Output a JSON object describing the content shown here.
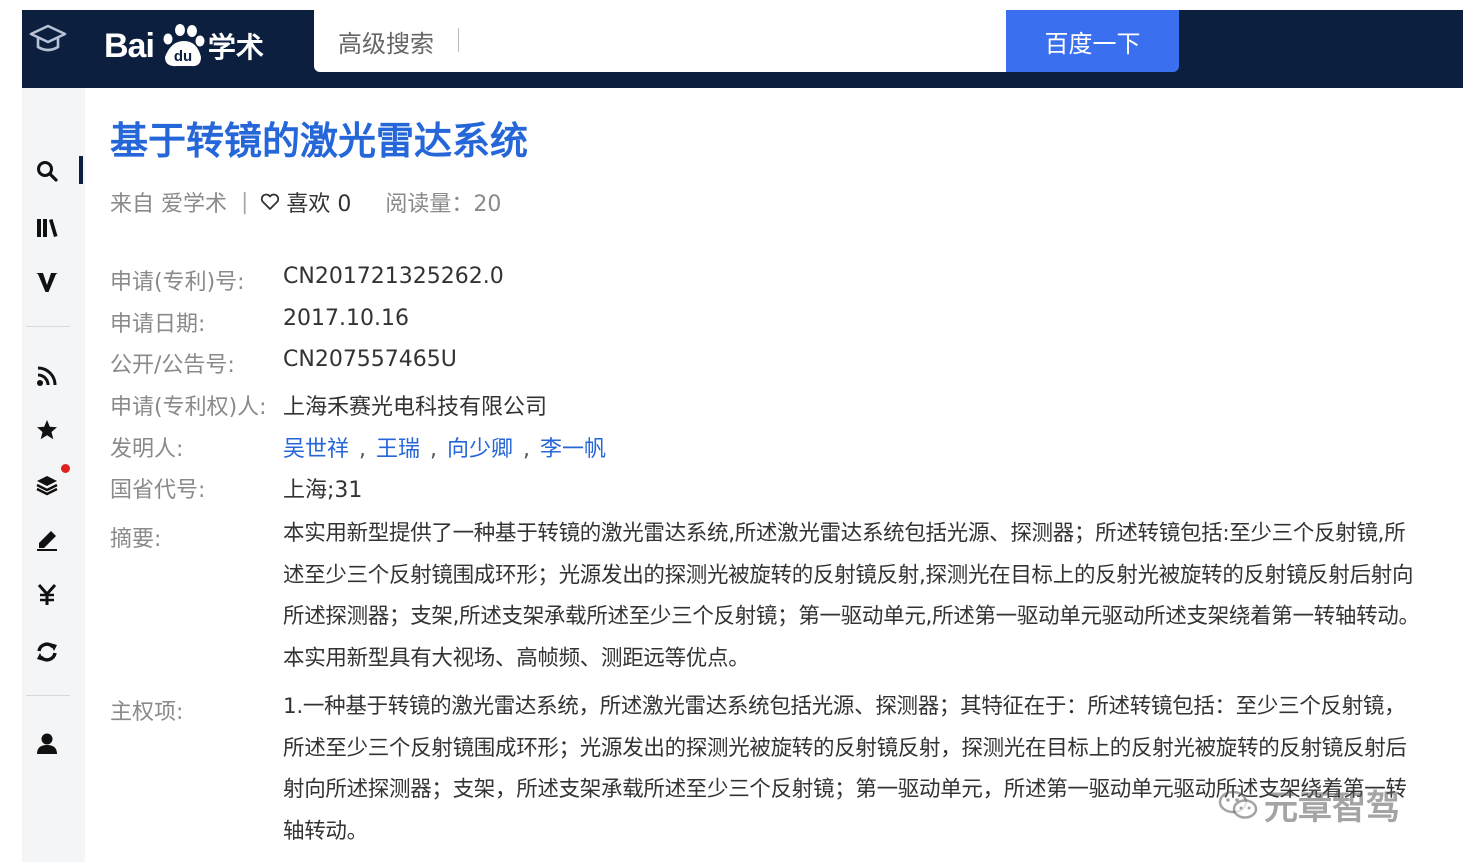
{
  "header": {
    "logo_bai": "Bai",
    "logo_du": "du",
    "logo_suffix": "学术",
    "search_value": "高级搜索",
    "search_button": "百度一下"
  },
  "sidebar": {
    "icons": [
      "search-icon",
      "library-icon",
      "v-icon",
      "rss-icon",
      "star-icon",
      "layers-icon",
      "pen-icon",
      "yen-icon",
      "refresh-icon",
      "user-icon"
    ]
  },
  "article": {
    "title": "基于转镜的激光雷达系统",
    "source": "来自 爱学术",
    "like_label": "喜欢 0",
    "reads": "阅读量：20",
    "fields": {
      "app_no_label": "申请(专利)号:",
      "app_no": "CN201721325262.0",
      "app_date_label": "申请日期:",
      "app_date": "2017.10.16",
      "pub_no_label": "公开/公告号:",
      "pub_no": "CN207557465U",
      "applicant_label": "申请(专利权)人:",
      "applicant": "上海禾赛光电科技有限公司",
      "inventors_label": "发明人:",
      "inventors": [
        "吴世祥",
        "王瑞",
        "向少卿",
        "李一帆"
      ],
      "code_label": "国省代号:",
      "code": "上海;31",
      "abstract_label": "摘要:",
      "abstract": "本实用新型提供了一种基于转镜的激光雷达系统,所述激光雷达系统包括光源、探测器；所述转镜包括:至少三个反射镜,所述至少三个反射镜围成环形；光源发出的探测光被旋转的反射镜反射,探测光在目标上的反射光被旋转的反射镜反射后射向所述探测器；支架,所述支架承载所述至少三个反射镜；第一驱动单元,所述第一驱动单元驱动所述支架绕着第一转轴转动。本实用新型具有大视场、高帧频、测距远等优点。",
      "claim_label": "主权项:",
      "claim": "1.一种基于转镜的激光雷达系统，所述激光雷达系统包括光源、探测器；其特征在于：所述转镜包括：至少三个反射镜，所述至少三个反射镜围成环形；光源发出的探测光被旋转的反射镜反射，探测光在目标上的反射光被旋转的反射镜反射后射向所述探测器；支架，所述支架承载所述至少三个反射镜；第一驱动单元，所述第一驱动单元驱动所述支架绕着第一转轴转动。"
    }
  },
  "watermark": "元章智驾",
  "colors": {
    "topbar": "#0c1f3f",
    "accent": "#3a6ff0",
    "link": "#2566d8"
  }
}
